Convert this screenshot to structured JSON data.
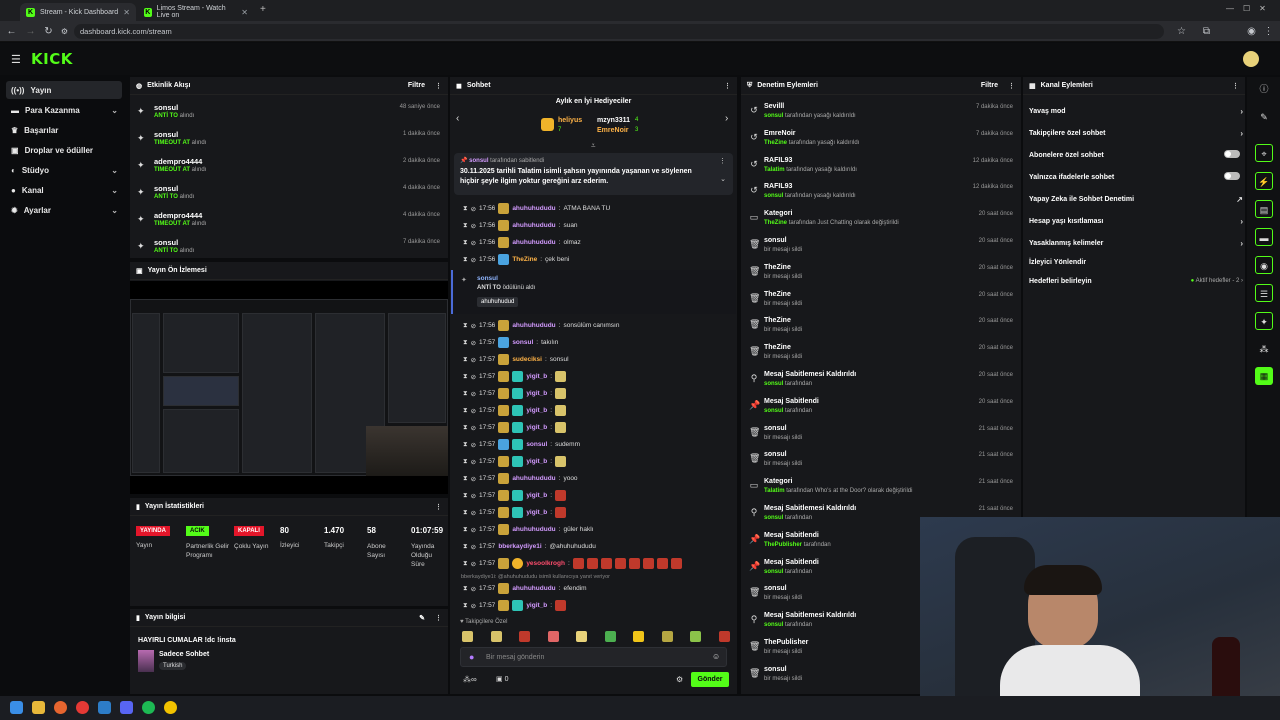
{
  "browser": {
    "tabs": [
      {
        "title": "Stream - Kick Dashboard"
      },
      {
        "title": "Limos Stream - Watch Live on "
      }
    ],
    "url": "dashboard.kick.com/stream"
  },
  "header": {
    "logo": "KICK"
  },
  "sidebar": {
    "items": [
      {
        "label": "Yayın",
        "icon": "broadcast-icon"
      },
      {
        "label": "Para Kazanma",
        "icon": "money-icon"
      },
      {
        "label": "Başarılar",
        "icon": "trophy-icon"
      },
      {
        "label": "Droplar ve ödüller",
        "icon": "gift-icon"
      },
      {
        "label": "Stüdyo",
        "icon": "palette-icon"
      },
      {
        "label": "Kanal",
        "icon": "user-icon"
      },
      {
        "label": "Ayarlar",
        "icon": "gear-icon"
      }
    ]
  },
  "activity": {
    "title": "Etkinlik Akışı",
    "filter": "Filtre",
    "rows": [
      {
        "name": "sonsul",
        "tag": "ANTİ TO",
        "suffix": "alındı",
        "time": "48 saniye önce"
      },
      {
        "name": "sonsul",
        "tag": "TIMEOUT AT",
        "suffix": "alındı",
        "time": "1 dakika önce"
      },
      {
        "name": "adempro4444",
        "tag": "TIMEOUT AT",
        "suffix": "alındı",
        "time": "2 dakika önce"
      },
      {
        "name": "sonsul",
        "tag": "ANTİ TO",
        "suffix": "alındı",
        "time": "4 dakika önce"
      },
      {
        "name": "adempro4444",
        "tag": "TIMEOUT AT",
        "suffix": "alındı",
        "time": "4 dakika önce"
      },
      {
        "name": "sonsul",
        "tag": "ANTİ TO",
        "suffix": "alındı",
        "time": "7 dakika önce"
      }
    ]
  },
  "preview": {
    "title": "Yayın Ön İzlemesi"
  },
  "stats": {
    "title": "Yayın İstatistikleri",
    "items": [
      {
        "badge": "YAYINDA",
        "label": "Yayın"
      },
      {
        "badge": "ACIK",
        "label": "Partnerlik Gelir Programı"
      },
      {
        "badge": "KAPALI",
        "label": "Çoklu Yayın"
      },
      {
        "value": "80",
        "label": "İzleyici"
      },
      {
        "value": "1.470",
        "label": "Takipçi"
      },
      {
        "value": "58",
        "label": "Abone Sayısı"
      },
      {
        "value": "01:07:59",
        "label": "Yayında Olduğu Süre"
      }
    ]
  },
  "info": {
    "title": "Yayın bilgisi",
    "stream_title": "HAYIRLI CUMALAR !dc !insta",
    "category": "Sadece Sohbet",
    "language": "Turkish"
  },
  "chat": {
    "title": "Sohbet",
    "gifters_title": "Aylık en İyi Hediyeciler",
    "gifters": [
      {
        "name": "heliyus",
        "count": "7"
      },
      {
        "name": "mzyn3311",
        "count": "4"
      },
      {
        "name": "EmreNoir",
        "count": "3"
      }
    ],
    "pinned_by": "sonsul",
    "pinned_suffix": "tarafından sabitlendi",
    "pinned_text": "30.11.2025 tarihli Talatim isimli şahsın yayınında yaşanan ve söylenen hiçbir şeyle ilgim yoktur gereğini arz ederim.",
    "messages": [
      {
        "time": "17:56",
        "user": "ahuhuhududu",
        "text": "ATMA BANA TU",
        "color": "#d39bff"
      },
      {
        "time": "17:56",
        "user": "ahuhuhududu",
        "text": "suan",
        "color": "#d39bff"
      },
      {
        "time": "17:56",
        "user": "ahuhuhududu",
        "text": "olmaz",
        "color": "#d39bff"
      },
      {
        "time": "17:56",
        "user": "TheZine",
        "text": "çek beni",
        "color": "#ffb347"
      }
    ],
    "redeem": {
      "user": "sonsul",
      "reward": "ANTİ TO",
      "suffix": "ödülünü aldı",
      "input": "ahuhuhudud"
    },
    "messages2": [
      {
        "time": "17:56",
        "user": "ahuhuhududu",
        "text": "sonsülüm canımsın",
        "color": "#d39bff"
      },
      {
        "time": "17:57",
        "user": "sonsul",
        "text": "takılın",
        "color": "#d39bff"
      },
      {
        "time": "17:57",
        "user": "sudeciksi",
        "text": "sonsul",
        "color": "#ffb347"
      },
      {
        "time": "17:57",
        "user": "yigit_b",
        "text": "",
        "color": "#d39bff"
      },
      {
        "time": "17:57",
        "user": "yigit_b",
        "text": "",
        "color": "#d39bff"
      },
      {
        "time": "17:57",
        "user": "yigit_b",
        "text": "",
        "color": "#d39bff"
      },
      {
        "time": "17:57",
        "user": "yigit_b",
        "text": "",
        "color": "#d39bff"
      },
      {
        "time": "17:57",
        "user": "sonsul",
        "text": "sudemm",
        "color": "#d39bff"
      },
      {
        "time": "17:57",
        "user": "yigit_b",
        "text": "",
        "color": "#d39bff"
      },
      {
        "time": "17:57",
        "user": "ahuhuhududu",
        "text": "yooo",
        "color": "#d39bff"
      },
      {
        "time": "17:57",
        "user": "yigit_b",
        "text": "",
        "color": "#d39bff"
      },
      {
        "time": "17:57",
        "user": "yigit_b",
        "text": "",
        "color": "#d39bff"
      },
      {
        "time": "17:57",
        "user": "ahuhuhududu",
        "text": "güler haklı",
        "color": "#d39bff"
      },
      {
        "time": "17:57",
        "user": "bberkaydiye1i",
        "text": "@ahuhuhududu",
        "color": "#d39bff"
      },
      {
        "time": "17:57",
        "user": "yesoolkrogh",
        "text": "",
        "color": "#ff4d6d"
      }
    ],
    "reply_note": "bberkaydiye1i: @ahuhuhududu isimli kullanıcıya yanıt veriyor",
    "messages3": [
      {
        "time": "17:57",
        "user": "ahuhuhududu",
        "text": "efendim",
        "color": "#d39bff"
      },
      {
        "time": "17:57",
        "user": "yigit_b",
        "text": "",
        "color": "#d39bff"
      }
    ],
    "followers_only": "Takipçilere Özel",
    "input_placeholder": "Bir mesaj gönderin",
    "send": "Gönder",
    "viewer_count": "0"
  },
  "moderation": {
    "title": "Denetim Eylemleri",
    "filter": "Filtre",
    "rows": [
      {
        "name": "Sevilll",
        "actor": "sonsul",
        "desc": "tarafından yasağı kaldırıldı",
        "time": "7 dakika önce",
        "icon": "undo-icon"
      },
      {
        "name": "EmreNoir",
        "actor": "TheZine",
        "desc": "tarafından yasağı kaldırıldı",
        "time": "7 dakika önce",
        "icon": "undo-icon"
      },
      {
        "name": "RAFIL93",
        "actor": "Talatim",
        "desc": "tarafından yasağı kaldırıldı",
        "time": "12 dakika önce",
        "icon": "undo-icon"
      },
      {
        "name": "RAFIL93",
        "actor": "sonsul",
        "desc": "tarafından yasağı kaldırıldı",
        "time": "12 dakika önce",
        "icon": "undo-icon"
      },
      {
        "name": "Kategori",
        "actor": "TheZine",
        "desc": "tarafından Just Chatting olarak değiştirildi",
        "time": "20 saat önce",
        "icon": "category-icon"
      },
      {
        "name": "sonsul",
        "actor": "",
        "desc": "bir mesajı sildi",
        "time": "20 saat önce",
        "icon": "trash-icon"
      },
      {
        "name": "TheZine",
        "actor": "",
        "desc": "bir mesajı sildi",
        "time": "20 saat önce",
        "icon": "trash-icon"
      },
      {
        "name": "TheZine",
        "actor": "",
        "desc": "bir mesajı sildi",
        "time": "20 saat önce",
        "icon": "trash-icon"
      },
      {
        "name": "TheZine",
        "actor": "",
        "desc": "bir mesajı sildi",
        "time": "20 saat önce",
        "icon": "trash-icon"
      },
      {
        "name": "TheZine",
        "actor": "",
        "desc": "bir mesajı sildi",
        "time": "20 saat önce",
        "icon": "trash-icon"
      },
      {
        "name": "Mesaj Sabitlemesi Kaldırıldı",
        "actor": "sonsul",
        "desc": "tarafından",
        "time": "20 saat önce",
        "icon": "unpin-icon"
      },
      {
        "name": "Mesaj Sabitlendi",
        "actor": "sonsul",
        "desc": "tarafından",
        "time": "20 saat önce",
        "icon": "pin-icon"
      },
      {
        "name": "sonsul",
        "actor": "",
        "desc": "bir mesajı sildi",
        "time": "21 saat önce",
        "icon": "trash-icon"
      },
      {
        "name": "sonsul",
        "actor": "",
        "desc": "bir mesajı sildi",
        "time": "21 saat önce",
        "icon": "trash-icon"
      },
      {
        "name": "Kategori",
        "actor": "Talatim",
        "desc": "tarafından Who's at the Door? olarak değiştirildi",
        "time": "21 saat önce",
        "icon": "category-icon"
      },
      {
        "name": "Mesaj Sabitlemesi Kaldırıldı",
        "actor": "sonsul",
        "desc": "tarafından",
        "time": "21 saat önce",
        "icon": "unpin-icon"
      },
      {
        "name": "Mesaj Sabitlendi",
        "actor": "ThePublisher",
        "desc": "tarafından",
        "time": "",
        "icon": "pin-icon"
      },
      {
        "name": "Mesaj Sabitlendi",
        "actor": "sonsul",
        "desc": "tarafından",
        "time": "",
        "icon": "pin-icon"
      },
      {
        "name": "sonsul",
        "actor": "",
        "desc": "bir mesajı sildi",
        "time": "",
        "icon": "trash-icon"
      },
      {
        "name": "Mesaj Sabitlemesi Kaldırıldı",
        "actor": "sonsul",
        "desc": "tarafından",
        "time": "",
        "icon": "unpin-icon"
      },
      {
        "name": "ThePublisher",
        "actor": "",
        "desc": "bir mesajı sildi",
        "time": "",
        "icon": "trash-icon"
      },
      {
        "name": "sonsul",
        "actor": "",
        "desc": "bir mesajı sildi",
        "time": "",
        "icon": "trash-icon"
      }
    ]
  },
  "channel": {
    "title": "Kanal Eylemleri",
    "items": [
      {
        "label": "Yavaş mod",
        "control": "chevron"
      },
      {
        "label": "Takipçilere özel sohbet",
        "control": "chevron"
      },
      {
        "label": "Abonelere özel sohbet",
        "control": "toggle"
      },
      {
        "label": "Yalnızca ifadelerle sohbet",
        "control": "toggle"
      },
      {
        "label": "Yapay Zeka ile Sohbet Denetimi",
        "control": "link"
      },
      {
        "label": "Hesap yaşı kısıtlaması",
        "control": "chevron"
      },
      {
        "label": "Yasaklanmış kelimeler",
        "control": "chevron"
      },
      {
        "label": "İzleyici Yönlendir",
        "control": "none"
      },
      {
        "label": "Hedefleri belirleyin",
        "control": "chevron",
        "note": "Aktif hedefler - 2"
      }
    ]
  },
  "colors": {
    "accent": "#53fc18",
    "live": "#e4162a",
    "panel": "#17181b"
  }
}
